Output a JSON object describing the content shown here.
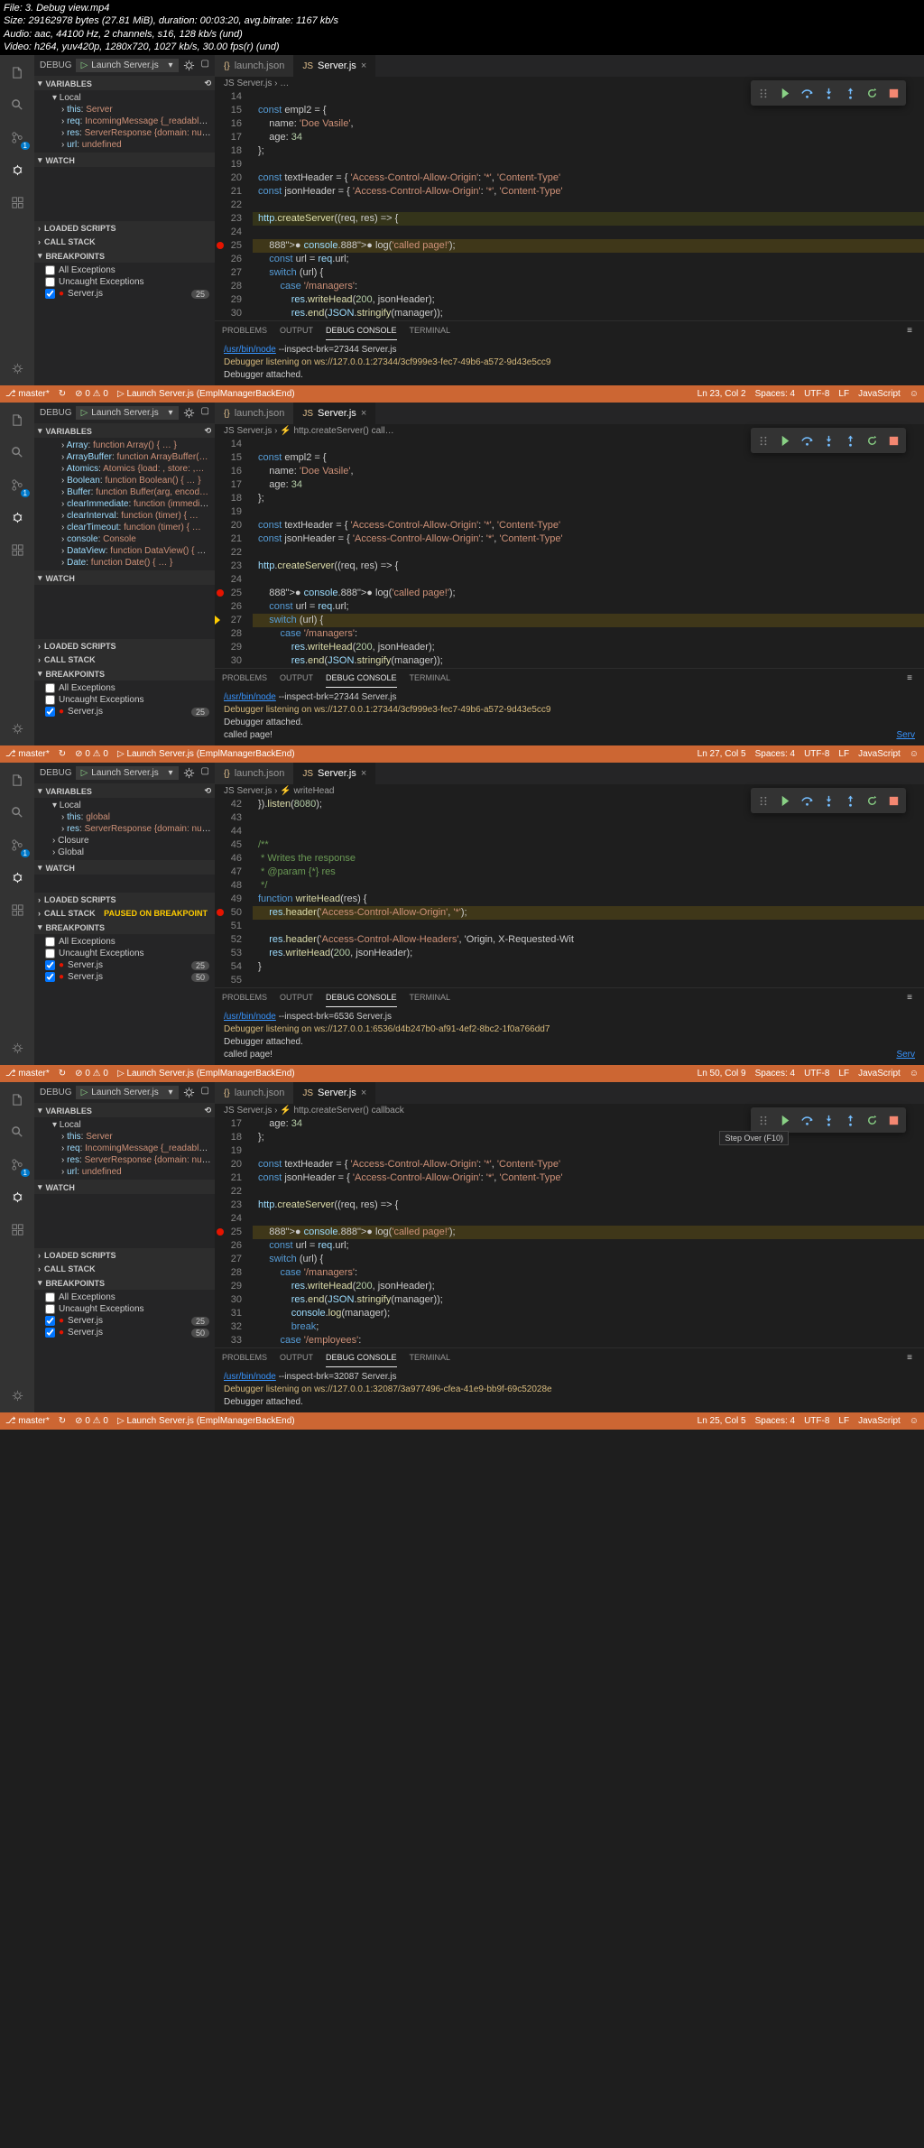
{
  "file_info": {
    "l1": "File: 3. Debug view.mp4",
    "l2": "Size: 29162978 bytes (27.81 MiB), duration: 00:03:20, avg.bitrate: 1167 kb/s",
    "l3": "Audio: aac, 44100 Hz, 2 channels, s16, 128 kb/s (und)",
    "l4": "Video: h264, yuv420p, 1280x720, 1027 kb/s, 30.00 fps(r) (und)"
  },
  "debug_label": "DEBUG",
  "launch_config": "Launch Server.js",
  "tabs": {
    "launch": "launch.json",
    "server": "Server.js"
  },
  "sections": {
    "variables": "VARIABLES",
    "watch": "WATCH",
    "loaded_scripts": "LOADED SCRIPTS",
    "call_stack": "CALL STACK",
    "breakpoints": "BREAKPOINTS",
    "local": "Local",
    "closure": "Closure",
    "global": "Global",
    "paused": "PAUSED ON BREAKPOINT"
  },
  "breakpoints": {
    "all_ex": "All Exceptions",
    "uncaught_ex": "Uncaught Exceptions",
    "server_js": "Server.js",
    "c25": "25",
    "c50": "50"
  },
  "panel": {
    "problems": "PROBLEMS",
    "output": "OUTPUT",
    "debug_console": "DEBUG CONSOLE",
    "terminal": "TERMINAL"
  },
  "status": {
    "branch": "master*",
    "sync": "↻",
    "err": "⊘ 0",
    "warn": "⚠ 0",
    "launch": "Launch Server.js (EmplManagerBackEnd)",
    "spaces": "Spaces: 4",
    "utf8": "UTF-8",
    "lf": "LF",
    "lang": "JavaScript",
    "feedback": "☺"
  },
  "instances": [
    {
      "vars": {
        "local_items": [
          "this: Server",
          "req: IncomingMessage {_readableSta…",
          "res: ServerResponse {domain: null,…",
          "url: undefined"
        ]
      },
      "breadcrumb": "JS Server.js › …",
      "code_start": 14,
      "current_line": 25,
      "breakpoints": [
        25
      ],
      "code": [
        "",
        "const empl2 = {",
        "    name: 'Doe Vasile',",
        "    age: 34",
        "};",
        "",
        "const textHeader = { 'Access-Control-Allow-Origin': '*', 'Content-Type'",
        "const jsonHeader = { 'Access-Control-Allow-Origin': '*', 'Content-Type'",
        "",
        "http.createServer((req, res) => {",
        "",
        "    ● console.● log('called page!');",
        "    const url = req.url;",
        "    switch (url) {",
        "        case '/managers':",
        "            res.writeHead(200, jsonHeader);",
        "            res.end(JSON.stringify(manager));"
      ],
      "console": [
        {
          "type": "link",
          "text": "/usr/bin/node",
          "suffix": " --inspect-brk=27344 Server.js"
        },
        {
          "type": "warn",
          "text": "Debugger listening on ws://127.0.0.1:27344/3cf999e3-fec7-49b6-a572-9d43e5cc9"
        },
        {
          "type": "text",
          "text": "Debugger attached."
        }
      ],
      "pos": "Ln 23, Col 2"
    },
    {
      "vars": {
        "global_items": [
          "Array: function Array() { … }",
          "ArrayBuffer: function ArrayBuffer(…",
          "Atomics: Atomics {load: , store: ,…",
          "Boolean: function Boolean() { … }",
          "Buffer: function Buffer(arg, encod…",
          "clearImmediate: function (immediat…",
          "clearInterval: function (timer) { …",
          "clearTimeout: function (timer) { …",
          "console: Console",
          "DataView: function DataView() { … …",
          "Date: function Date() { … }"
        ]
      },
      "breadcrumb": "JS Server.js › ⚡ http.createServer() call…",
      "code_start": 14,
      "current_line": 27,
      "breakpoints": [
        25
      ],
      "code": [
        "",
        "const empl2 = {",
        "    name: 'Doe Vasile',",
        "    age: 34",
        "};",
        "",
        "const textHeader = { 'Access-Control-Allow-Origin': '*', 'Content-Type'",
        "const jsonHeader = { 'Access-Control-Allow-Origin': '*', 'Content-Type'",
        "",
        "http.createServer((req, res) => {",
        "",
        "    ● console.● log('called page!');",
        "    const url = req.url;",
        "    switch (url) {",
        "        case '/managers':",
        "            res.writeHead(200, jsonHeader);",
        "            res.end(JSON.stringify(manager));"
      ],
      "console": [
        {
          "type": "link",
          "text": "/usr/bin/node",
          "suffix": " --inspect-brk=27344 Server.js"
        },
        {
          "type": "warn",
          "text": "Debugger listening on ws://127.0.0.1:27344/3cf999e3-fec7-49b6-a572-9d43e5cc9"
        },
        {
          "type": "text",
          "text": "Debugger attached."
        },
        {
          "type": "text",
          "text": "called page!",
          "right": "Serv"
        }
      ],
      "pos": "Ln 27, Col 5"
    },
    {
      "vars": {
        "local_items": [
          "this: global",
          "res: ServerResponse {domain: null,…"
        ],
        "closure": true,
        "global": true
      },
      "breadcrumb": "JS Server.js › ⚡ writeHead",
      "code_start": 42,
      "current_line": 50,
      "breakpoints": [
        50
      ],
      "code": [
        "}).listen(8080);",
        "",
        "",
        "/**",
        " * Writes the response",
        " * @param {*} res",
        " */",
        "function writeHead(res) {",
        "    res.header('Access-Control-Allow-Origin', '*');",
        "",
        "    res.header('Access-Control-Allow-Headers', 'Origin, X-Requested-Wit",
        "    res.writeHead(200, jsonHeader);",
        "}",
        ""
      ],
      "console": [
        {
          "type": "link",
          "text": "/usr/bin/node",
          "suffix": " --inspect-brk=6536 Server.js"
        },
        {
          "type": "warn",
          "text": "Debugger listening on ws://127.0.0.1:6536/d4b247b0-af91-4ef2-8bc2-1f0a766dd7"
        },
        {
          "type": "text",
          "text": "Debugger attached."
        },
        {
          "type": "text",
          "text": "called page!",
          "right": "Serv"
        }
      ],
      "paused": true,
      "double_bp": true,
      "pos": "Ln 50, Col 9"
    },
    {
      "vars": {
        "local_items": [
          "this: Server",
          "req: IncomingMessage {_readableSta…",
          "res: ServerResponse {domain: null,…",
          "url: undefined"
        ]
      },
      "breadcrumb": "JS Server.js › ⚡ http.createServer() callback",
      "tooltip": "Step Over (F10)",
      "code_start": 17,
      "current_line": 25,
      "breakpoints": [
        25
      ],
      "code": [
        "    age: 34",
        "};",
        "",
        "const textHeader = { 'Access-Control-Allow-Origin': '*', 'Content-Type'",
        "const jsonHeader = { 'Access-Control-Allow-Origin': '*', 'Content-Type'",
        "",
        "http.createServer((req, res) => {",
        "",
        "    ● console.● log('called page!');",
        "    const url = req.url;",
        "    switch (url) {",
        "        case '/managers':",
        "            res.writeHead(200, jsonHeader);",
        "            res.end(JSON.stringify(manager));",
        "            console.log(manager);",
        "            break;",
        "        case '/employees':"
      ],
      "console": [
        {
          "type": "link",
          "text": "/usr/bin/node",
          "suffix": " --inspect-brk=32087 Server.js"
        },
        {
          "type": "warn",
          "text": "Debugger listening on ws://127.0.0.1:32087/3a977496-cfea-41e9-bb9f-69c52028e"
        },
        {
          "type": "text",
          "text": "Debugger attached."
        }
      ],
      "double_bp": true,
      "pos": "Ln 25, Col 5"
    }
  ]
}
